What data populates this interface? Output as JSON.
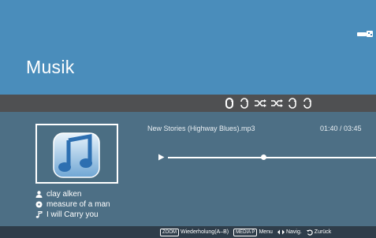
{
  "header": {
    "title": "Musik",
    "icon": "usb-connector-icon"
  },
  "playback_modes": [
    "repeat-one-icon",
    "repeat-icon",
    "shuffle-icon",
    "shuffle-icon",
    "repeat-icon",
    "repeat-icon"
  ],
  "track": {
    "title": "New Stories (Highway Blues).mp3",
    "time": "01:40 / 03:45",
    "progress": 0.46
  },
  "metadata": {
    "artist": "clay alken",
    "album": "measure of a man",
    "song": "I will Carry you"
  },
  "footer": {
    "zoom_key": "ZOOM",
    "zoom_label": "Wiederholung(A–B)",
    "media_key": "MEDIA P",
    "media_label": "Menu",
    "navig_label": "Navig.",
    "back_label": "Zurück"
  },
  "colors": {
    "header": "#4a8dbb",
    "body": "#4d6f85",
    "strip": "#4f5052",
    "footer": "#2f3d4a"
  }
}
